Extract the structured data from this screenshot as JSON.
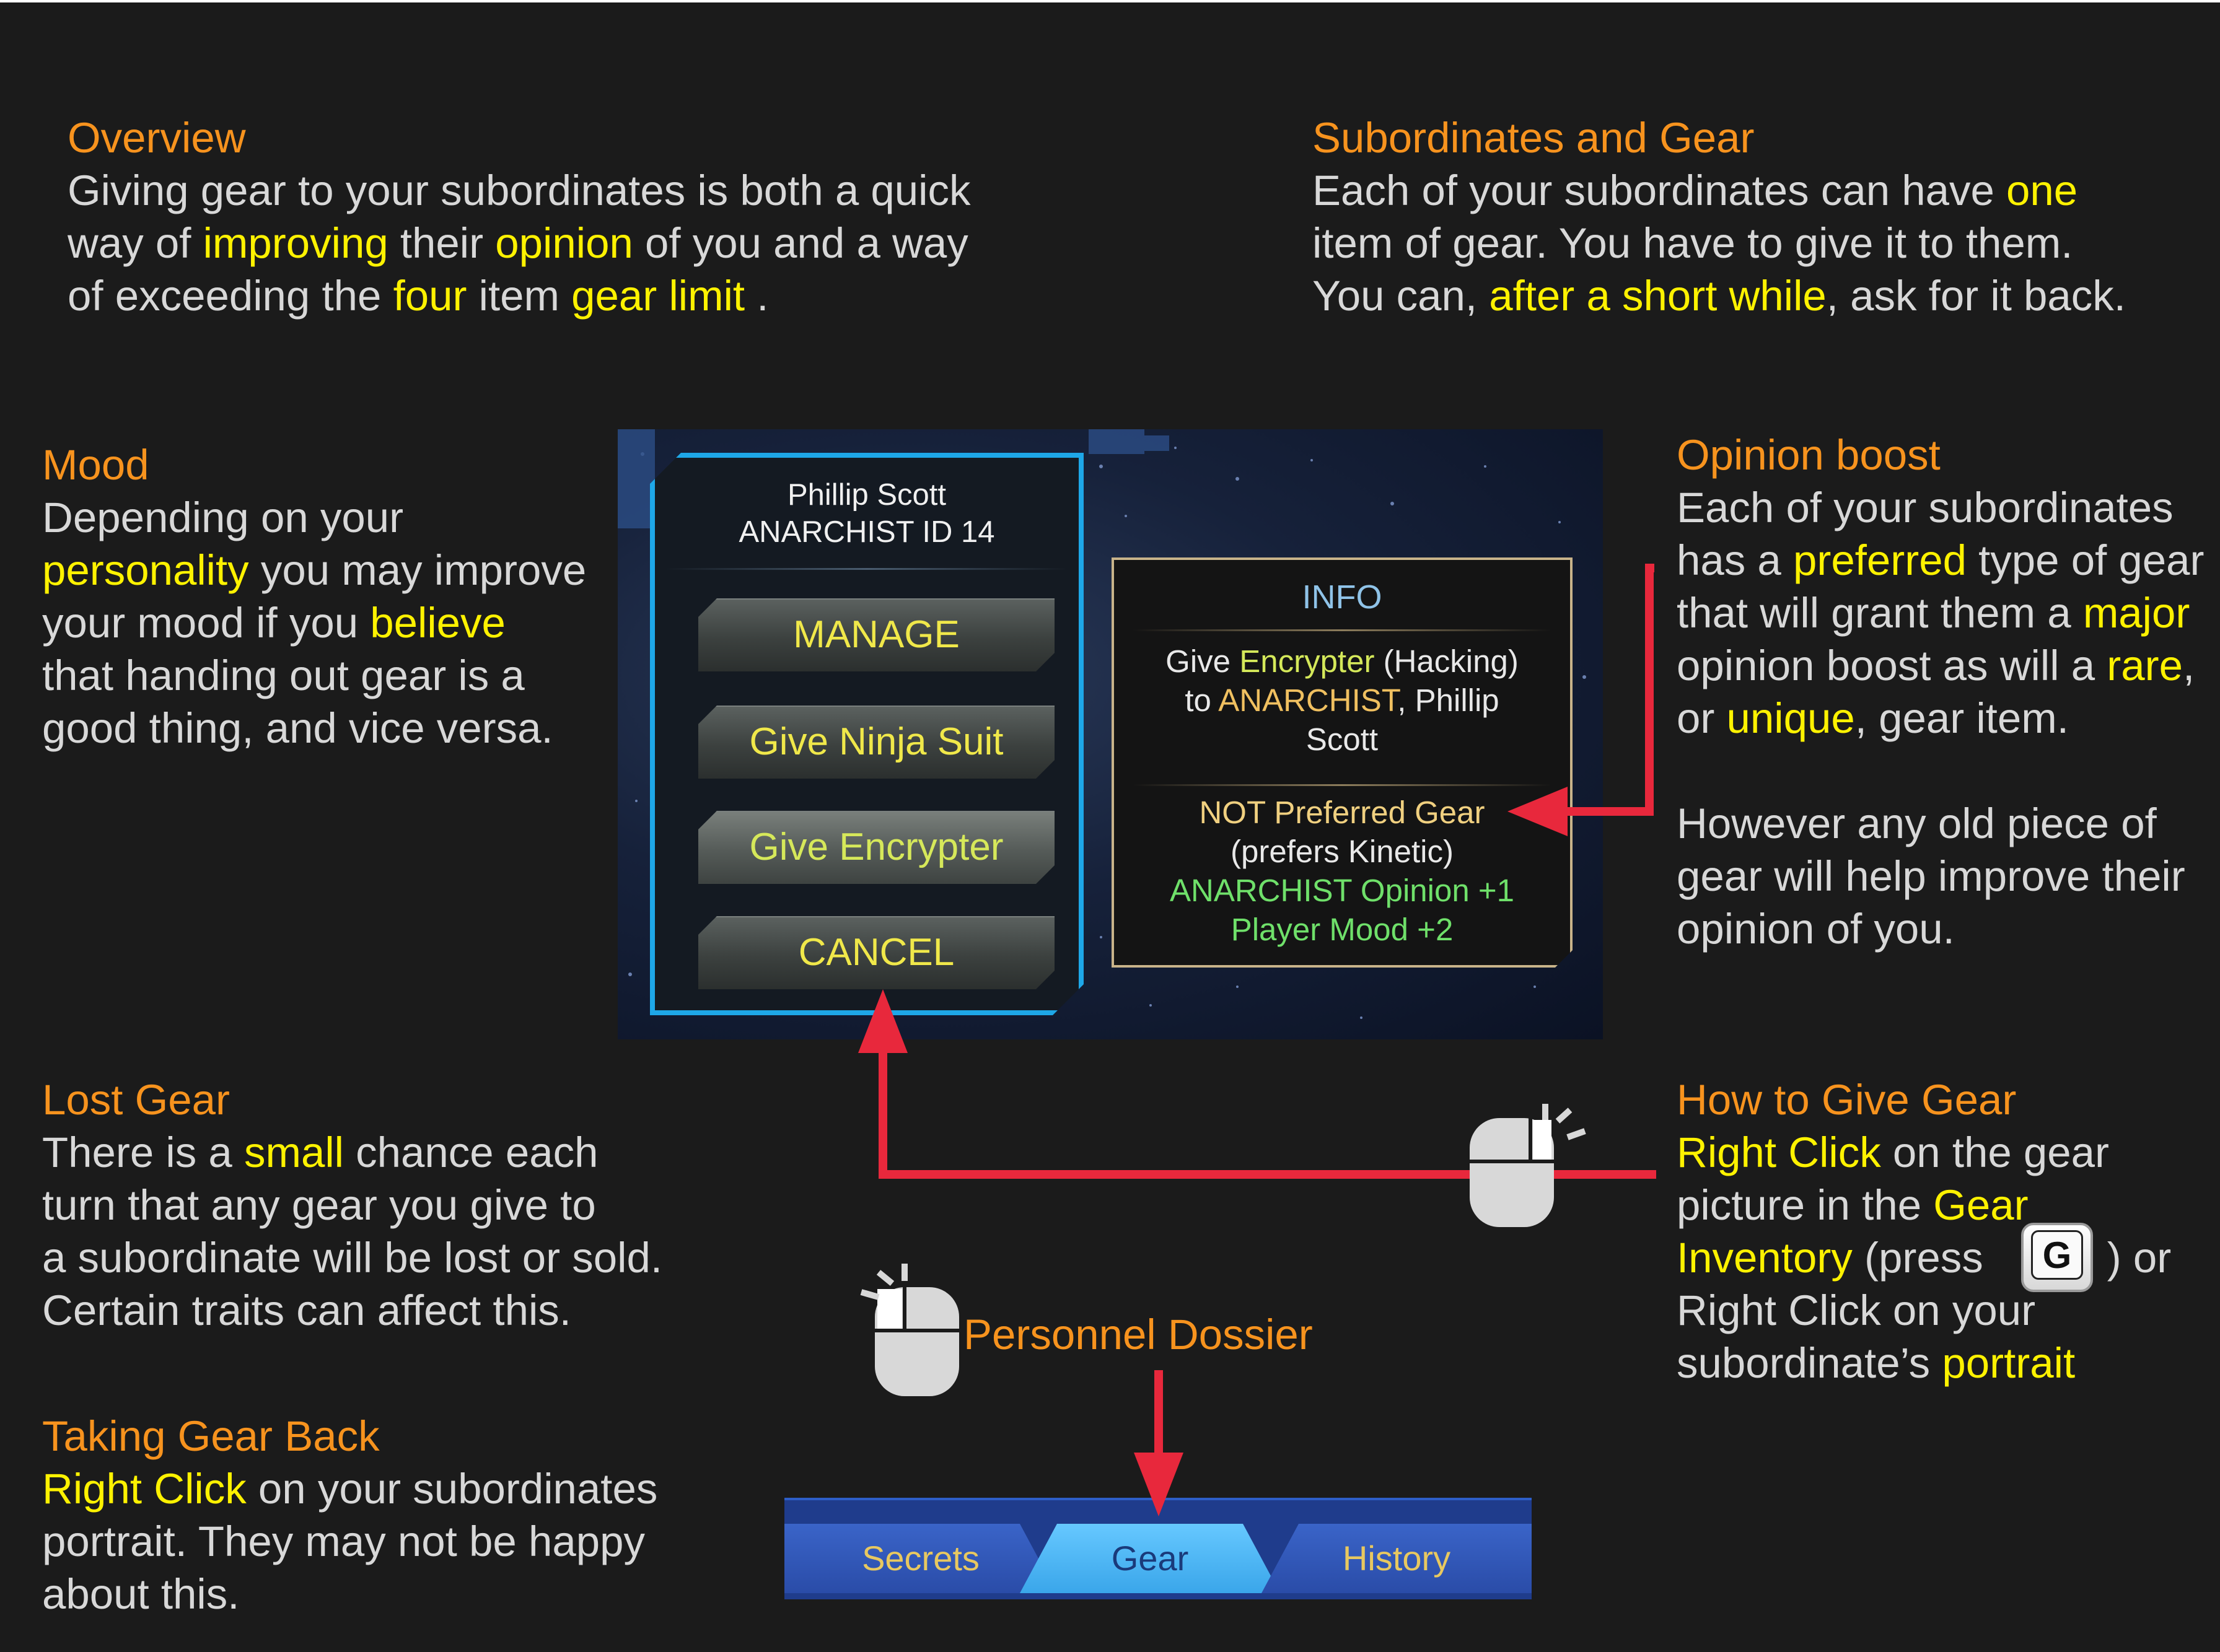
{
  "overview": {
    "heading": "Overview",
    "t1": "Giving gear to your subordinates is both a quick",
    "t2a": "way of ",
    "t2b": "improving",
    "t2c": " their ",
    "t2d": "opinion",
    "t2e": " of you and a way",
    "t3a": "of exceeding the ",
    "t3b": "four",
    "t3c": " item ",
    "t3d": "gear limit",
    "t3e": " ."
  },
  "subordinates_gear": {
    "heading": "Subordinates and Gear",
    "t1a": "Each of your subordinates can have ",
    "t1b": "one",
    "t2": "item of gear. You have to give it to them.",
    "t3a": "You can, ",
    "t3b": "after a short while",
    "t3c": ", ask for it back."
  },
  "mood": {
    "heading": "Mood",
    "t1": "Depending on your",
    "t2a": "personality",
    "t2b": " you may improve",
    "t3a": "your mood if you ",
    "t3b": "believe",
    "t4": "that handing out gear is a",
    "t5": "good thing, and vice versa."
  },
  "opinion_boost": {
    "heading": "Opinion boost",
    "t1": "Each of your subordinates",
    "t2a": "has a ",
    "t2b": "preferred",
    "t2c": " type of gear",
    "t3a": "that will grant them a ",
    "t3b": "major",
    "t4a": "opinion boost as will a ",
    "t4b": "rare",
    "t4c": ",",
    "t5a": "or ",
    "t5b": "unique",
    "t5c": ", gear item.",
    "t6": "However any old piece of",
    "t7": "gear will help improve their",
    "t8": "opinion of you."
  },
  "lost_gear": {
    "heading": "Lost Gear",
    "t1a": "There is a ",
    "t1b": "small",
    "t1c": " chance each",
    "t2": "turn that any gear you give to",
    "t3": "a subordinate will be lost or sold.",
    "t4": "Certain traits can affect this."
  },
  "taking_back": {
    "heading": "Taking Gear Back",
    "t1a": "Right Click",
    "t1b": " on your subordinates",
    "t2": "portrait. They may not be happy",
    "t3": "about this."
  },
  "how_to_give": {
    "heading": "How to Give Gear",
    "t1a": "Right Click",
    "t1b": " on the gear",
    "t2a": "picture in the ",
    "t2b": "Gear",
    "t3a": "Inventory",
    "t3b": " (press",
    "t3c": ") or",
    "t4": "Right Click on your",
    "t5a": "subordinate’s ",
    "t5b": "portrait",
    "key": "G"
  },
  "personnel_dossier": {
    "label": "Personnel Dossier"
  },
  "dialog": {
    "name": "Phillip Scott",
    "id_line": "ANARCHIST ID 14",
    "buttons": [
      "MANAGE",
      "Give Ninja Suit",
      "Give Encrypter",
      "CANCEL"
    ],
    "info_title": "INFO",
    "desc_a": "Give ",
    "desc_b": "Encrypter",
    "desc_c": " (Hacking)",
    "desc_d": "to ",
    "desc_e": "ANARCHIST",
    "desc_f": ", Phillip",
    "desc_g": "Scott",
    "stat1": "NOT Preferred Gear",
    "stat2": "(prefers Kinetic)",
    "stat3": "ANARCHIST Opinion +1",
    "stat4": "Player Mood +2"
  },
  "tabs": {
    "items": [
      "Secrets",
      "Gear",
      "History"
    ],
    "active": "Gear"
  },
  "colors": {
    "background": "#1b1b1b",
    "heading": "#f7931e",
    "highlight": "#fff200",
    "body_text": "#d8d8d8",
    "arrow": "#e8283c",
    "panel_border": "#1ea7e8"
  },
  "icons": [
    "mouse-right-click-icon",
    "mouse-left-click-icon",
    "keyboard-key-icon"
  ]
}
